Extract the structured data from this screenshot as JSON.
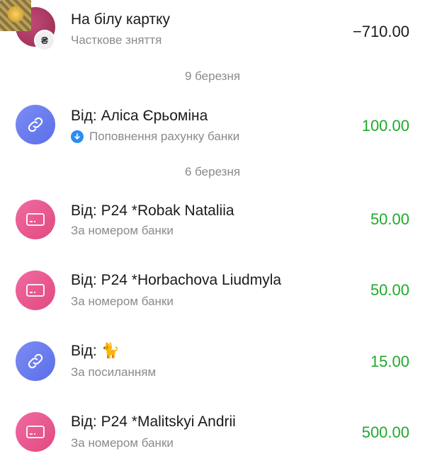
{
  "colors": {
    "amount_positive": "#1faa2b",
    "amount_negative": "#1a1a1a",
    "avatar_pink": "#e8568c",
    "avatar_blue": "#6a7cf0",
    "info_blue": "#2d8cf0"
  },
  "transactions": [
    {
      "title": "На білу картку",
      "subtitle": "Часткове зняття",
      "amount": "−710.00",
      "avatar_icon": "profile-photo",
      "badge_symbol": "₴",
      "badge_icon": "hryvnia-icon"
    },
    {
      "title": "Від: Аліса Єрьоміна",
      "subtitle": "Поповнення рахунку банки",
      "subtitle_icon": "arrow-down-circle-icon",
      "amount": "100.00",
      "avatar_icon": "link-icon"
    },
    {
      "title": "Від: P24 *Robak Nataliia",
      "subtitle": "За номером банки",
      "amount": "50.00",
      "avatar_icon": "card-icon"
    },
    {
      "title": "Від: P24 *Horbachova Liudmyla",
      "subtitle": "За номером банки",
      "amount": "50.00",
      "avatar_icon": "card-icon"
    },
    {
      "title_prefix": "Від: ",
      "title_emoji": "🐈",
      "subtitle": "За посиланням",
      "amount": "15.00",
      "avatar_icon": "link-icon"
    },
    {
      "title": "Від: P24 *Malitskyi Andrii",
      "subtitle": "За номером банки",
      "amount": "500.00",
      "avatar_icon": "card-icon"
    }
  ],
  "date_headers": [
    "9 березня",
    "6 березня"
  ]
}
